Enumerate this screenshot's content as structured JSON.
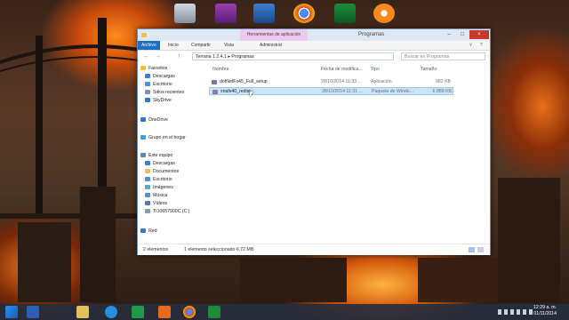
{
  "window": {
    "title": "Programas",
    "context_tab": "Herramientas de aplicación",
    "ribbon_tabs": [
      "Archivo",
      "Inicio",
      "Compartir",
      "Vista",
      "Administrar"
    ],
    "address_path": [
      "Terraria 1.2.4.1",
      "Programas"
    ],
    "search_placeholder": "Buscar en Programas"
  },
  "sidebar": {
    "favoritos": "Favoritos",
    "fav_items": [
      "Descargas",
      "Escritorio",
      "Sitios recientes",
      "SkyDrive"
    ],
    "onedrive": "OneDrive",
    "grupo": "Grupo en el hogar",
    "equipo": "Este equipo",
    "equipo_items": [
      "Descargas",
      "Documentos",
      "Escritorio",
      "Imágenes",
      "Música",
      "Vídeos",
      "TI10657900C (C:)"
    ],
    "red": "Red"
  },
  "columns": [
    "Nombre",
    "Fecha de modifica...",
    "Tipo",
    "Tamaño"
  ],
  "files": [
    {
      "name": "dotNetFx45_Full_setup",
      "date": "28/10/2014 11:33 ...",
      "type": "Aplicación",
      "size": "982 KB"
    },
    {
      "name": "xnafx40_redist",
      "date": "28/10/2014 11:31 ...",
      "type": "Paquete de Windo...",
      "size": "6.889 KB"
    }
  ],
  "status": {
    "count": "2 elementos",
    "selected": "1 elemento seleccionado 6.72 MB"
  },
  "clock": {
    "time": "12:29 a. m.",
    "date": "01/11/2014"
  },
  "colors": {
    "accent": "#1f6fc0",
    "selection": "#cce4f9",
    "context_tab": "#f0c9ef"
  }
}
